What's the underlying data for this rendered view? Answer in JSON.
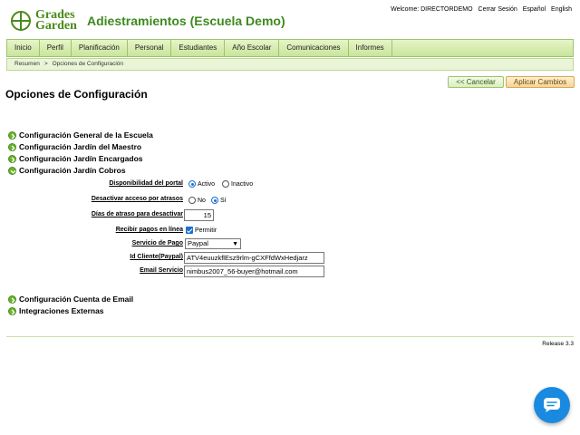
{
  "header": {
    "logo_line1": "Grades",
    "logo_line2": "Garden",
    "app_title": "Adiestramientos (Escuela Demo)",
    "welcome": "Welcome: DIRECTORDEMO",
    "logout": "Cerrar Sesión",
    "lang_es": "Español",
    "lang_en": "English"
  },
  "nav": {
    "items": [
      {
        "label": "Inicio"
      },
      {
        "label": "Perfil"
      },
      {
        "label": "Planificación"
      },
      {
        "label": "Personal"
      },
      {
        "label": "Estudiantes"
      },
      {
        "label": "Año Escolar"
      },
      {
        "label": "Comunicaciones"
      },
      {
        "label": "Informes"
      }
    ]
  },
  "breadcrumb": {
    "root": "Resumen",
    "separator": ">",
    "current": "Opciones de Configuración"
  },
  "actions": {
    "cancel": "<< Cancelar",
    "apply": "Aplicar Cambios"
  },
  "page_title": "Opciones de Configuración",
  "sections": [
    {
      "label": "Configuración General de la Escuela",
      "expanded": false
    },
    {
      "label": "Configuración Jardín del Maestro",
      "expanded": false
    },
    {
      "label": "Configuración Jardín Encargados",
      "expanded": false
    },
    {
      "label": "Configuración Jardín Cobros",
      "expanded": true
    },
    {
      "label": "Configuración Cuenta de Email",
      "expanded": false
    },
    {
      "label": "Integraciones Externas",
      "expanded": false
    }
  ],
  "cobros_form": {
    "portal_label": "Disponibilidad del portal",
    "portal_active": "Activo",
    "portal_inactive": "Inactivo",
    "deactivate_label": "Desactivar acceso por atrasos",
    "no": "No",
    "yes": "Sí",
    "days_label": "Días de atraso para desactivar",
    "days_value": "15",
    "online_label": "Recibir pagos en línea",
    "allow": "Permitir",
    "service_label": "Servicio de Pago",
    "service_value": "Paypal",
    "client_id_label": "Id Cliente(Paypal)",
    "client_id_value": "ATV4euuzkflEsz9rlm-gCXFfdWxHedjarz",
    "email_label": "Email Servicio",
    "email_value": "nimbus2007_56-buyer@hotmail.com"
  },
  "footer": {
    "release": "Release 3.3"
  },
  "colors": {
    "brand_green": "#3e8a1e",
    "nav_bg": "#c9e59a",
    "chat_blue": "#1a8ae0"
  }
}
